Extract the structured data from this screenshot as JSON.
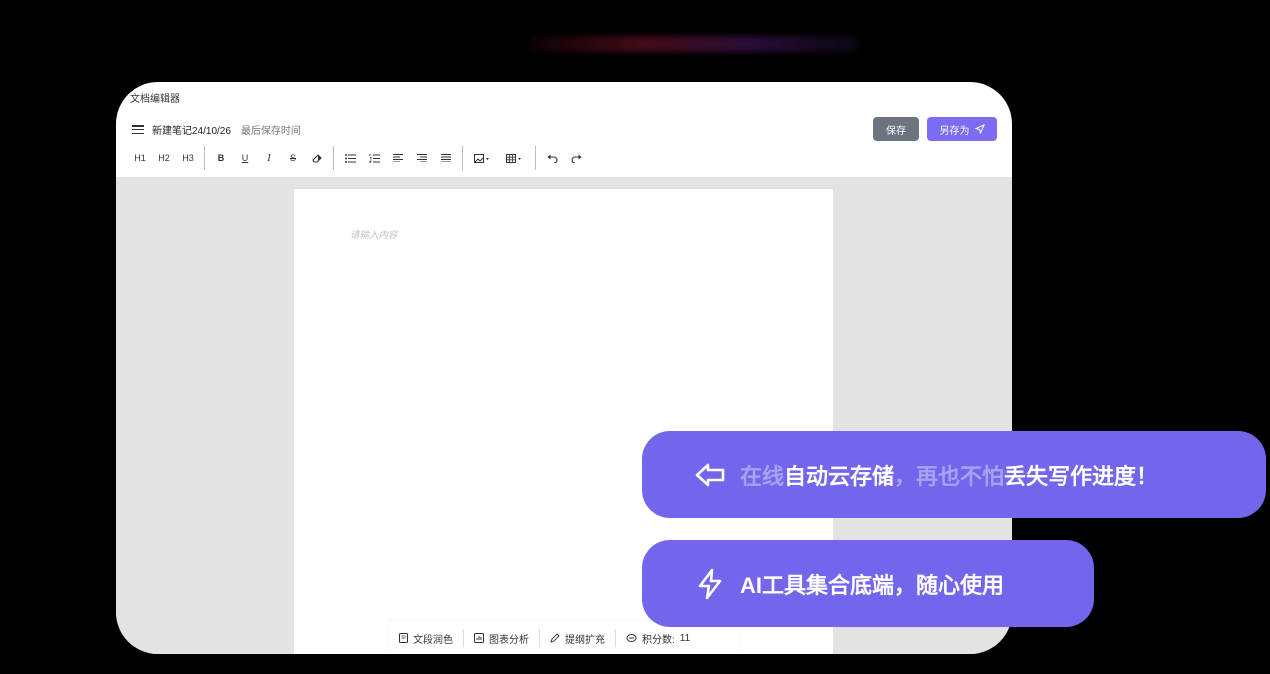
{
  "app": {
    "title": "文档编辑器"
  },
  "document": {
    "name": "新建笔记24/10/26",
    "save_status": "最后保存时间",
    "placeholder": "请输入内容"
  },
  "header_buttons": {
    "save_label": "保存",
    "save_as_label": "另存为"
  },
  "toolbar": {
    "headings": [
      "H1",
      "H2",
      "H3"
    ],
    "formatting_icons": [
      "bold-icon",
      "underline-icon",
      "italic-icon",
      "strikethrough-icon",
      "eraser-icon"
    ],
    "list_align_icons": [
      "bullet-list-icon",
      "numbered-list-icon",
      "align-left-icon",
      "align-right-icon",
      "align-justify-icon"
    ],
    "insert_icons": [
      "image-icon",
      "table-icon"
    ],
    "history_icons": [
      "undo-icon",
      "redo-icon"
    ]
  },
  "bottom_bar": {
    "polish_label": "文段润色",
    "chart_label": "图表分析",
    "outline_label": "提纲扩充",
    "points_label": "积分数:",
    "points_value": "11"
  },
  "promo": {
    "pill1": {
      "part1": "在线",
      "part2": "自动云存储",
      "part3": "，再也不怕",
      "part4": "丢失写作进度！"
    },
    "pill2": {
      "text": "AI工具集合底端，随心使用"
    }
  },
  "colors": {
    "accent": "#7366ed",
    "save_button": "#6e7380",
    "canvas": "#e3e3e3"
  }
}
